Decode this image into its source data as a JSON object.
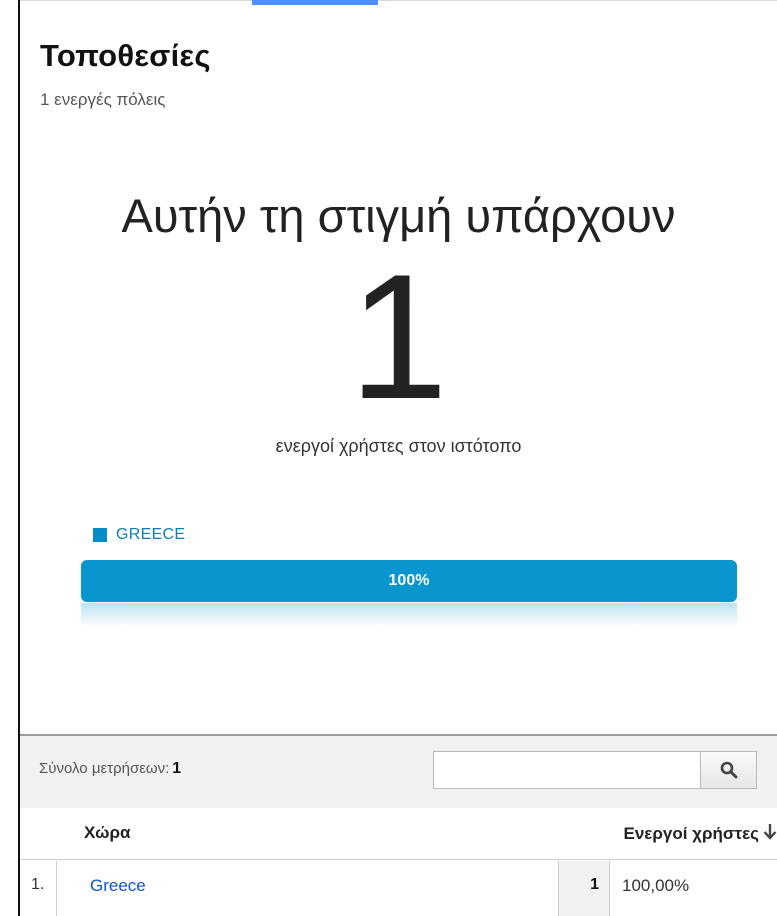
{
  "header": {
    "title": "Τοποθεσίες",
    "subtitle": "1 ενεργές πόλεις"
  },
  "realtime": {
    "headline": "Αυτήν τη στιγμή υπάρχουν",
    "active_count": "1",
    "caption": "ενεργοί χρήστες στον ιστότοπο"
  },
  "breakdown": {
    "legend_label": "GREECE",
    "legend_color": "#058dc7",
    "bar_label": "100%",
    "bar_fraction": 1.0
  },
  "table": {
    "total_label": "Σύνολο μετρήσεων:",
    "total_value": "1",
    "search_placeholder": "",
    "search_icon": "search-icon",
    "columns": {
      "country": "Χώρα",
      "active_users": "Ενεργοί χρήστες"
    },
    "sort_icon": "arrow-down-icon",
    "rows": [
      {
        "index": "1.",
        "country": "Greece",
        "count": "1",
        "percent": "100,00%"
      }
    ]
  }
}
